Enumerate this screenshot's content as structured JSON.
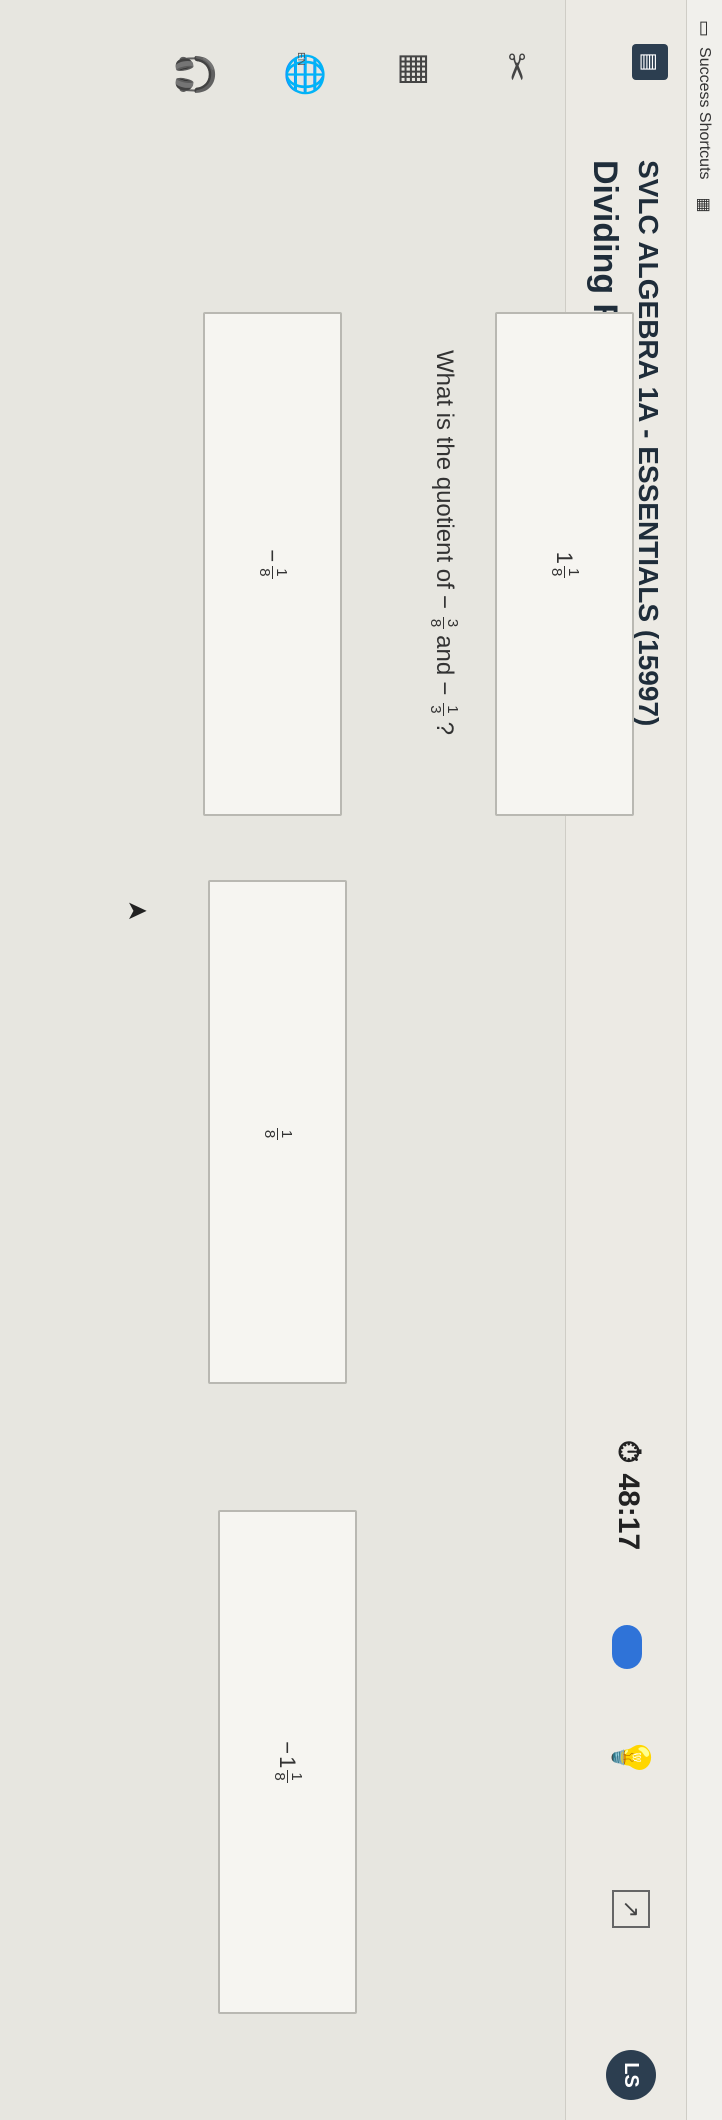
{
  "bookmarks": {
    "label": "Success Shortcuts"
  },
  "header": {
    "course": "SVLC ALGEBRA 1A - ESSENTIALS (15997)",
    "lesson": "Dividing Fractions",
    "timer": "48:17",
    "avatar_initials": "LS"
  },
  "toolbar": {
    "lang": "EN"
  },
  "question": {
    "prefix": "What is the quotient of",
    "frac1": {
      "sign": "−",
      "num": "3",
      "den": "8"
    },
    "middle": "and",
    "frac2": {
      "sign": "−",
      "num": "1",
      "den": "3"
    },
    "suffix": "?"
  },
  "choices": [
    {
      "sign": "−",
      "whole": "",
      "num": "1",
      "den": "8"
    },
    {
      "sign": "",
      "whole": "1",
      "num": "1",
      "den": "8"
    },
    {
      "sign": "",
      "whole": "",
      "num": "1",
      "den": "8"
    },
    {
      "sign": "−",
      "whole": "1",
      "num": "1",
      "den": "8"
    }
  ],
  "colors": {
    "accent": "#2f73d8",
    "dark": "#2c3e50"
  }
}
